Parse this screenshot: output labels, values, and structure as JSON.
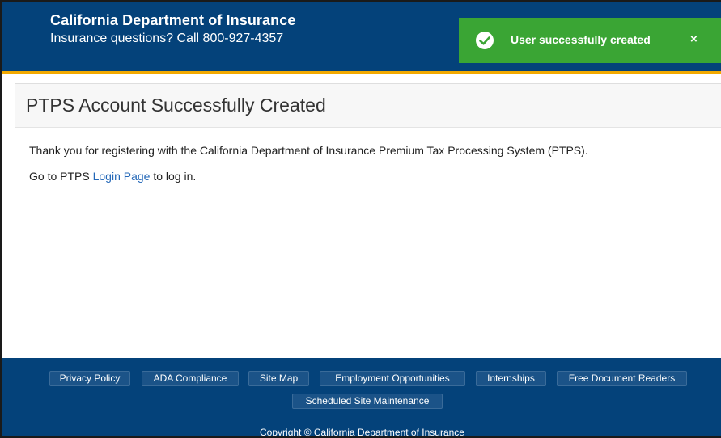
{
  "header": {
    "title": "California Department of Insurance",
    "phone_line": "Insurance questions? Call 800-927-4357"
  },
  "toast": {
    "message": "User successfully created",
    "close": "×",
    "color": "#3aa534"
  },
  "card": {
    "title": "PTPS Account Successfully Created",
    "thanks": "Thank you for registering with the California Department of Insurance Premium Tax Processing System (PTPS).",
    "goto_prefix": "Go to PTPS ",
    "login_link": "Login Page",
    "goto_suffix": " to log in."
  },
  "footer": {
    "links": [
      "Privacy Policy",
      "ADA Compliance",
      "Site Map",
      "Employment Opportunities",
      "Internships",
      "Free Document Readers",
      "Scheduled Site Maintenance"
    ],
    "copyright": "Copyright © California Department of Insurance"
  },
  "colors": {
    "header_bg": "#04427a",
    "accent_rule": "#f2a900",
    "link": "#2468b8"
  }
}
